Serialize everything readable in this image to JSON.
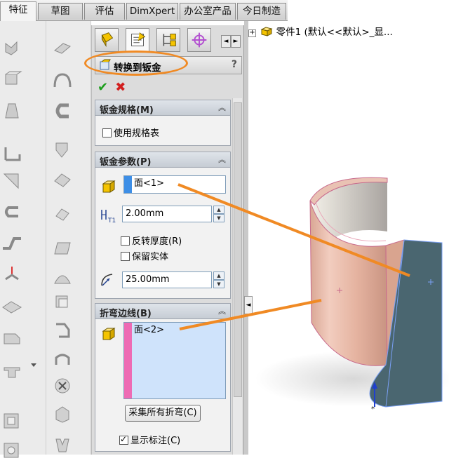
{
  "top_tabs": [
    {
      "label": "特征",
      "active": true
    },
    {
      "label": "草图",
      "active": false
    },
    {
      "label": "评估",
      "active": false
    },
    {
      "label": "DimXpert",
      "active": false
    },
    {
      "label": "办公室产品",
      "active": false
    },
    {
      "label": "今日制造",
      "active": false
    }
  ],
  "property_manager": {
    "title": "转换到钣金",
    "help": "?",
    "ok_symbol": "✔",
    "cancel_symbol": "✖",
    "scroll_left": "◄",
    "scroll_right": "►"
  },
  "gauge_group": {
    "header": "钣金规格(M)",
    "use_gauge_table": {
      "label": "使用规格表",
      "checked": false
    }
  },
  "params_group": {
    "header": "钣金参数(P)",
    "face_selection": "面<1>",
    "thickness": "2.00mm",
    "thickness_icon_label": "T1",
    "reverse_thickness": {
      "label": "反转厚度(R)",
      "checked": false
    },
    "keep_body": {
      "label": "保留实体",
      "checked": false
    },
    "bend_radius": "25.00mm"
  },
  "bend_edges_group": {
    "header": "折弯边线(B)",
    "edge_selection": "面<2>",
    "collect_button": "采集所有折弯(C)",
    "show_callouts": {
      "label": "显示标注(C)",
      "checked": true
    }
  },
  "feature_tree": {
    "expand_symbol": "+",
    "root_label": "零件1  (默认<<默认>_显..."
  },
  "colors": {
    "orange_annotation": "#f08a24",
    "part_copper": "#e9b8a4",
    "part_selected_face": "#4a6670",
    "selection_blue": "#3d8ee6",
    "selection_pink": "#ee6bb4"
  }
}
